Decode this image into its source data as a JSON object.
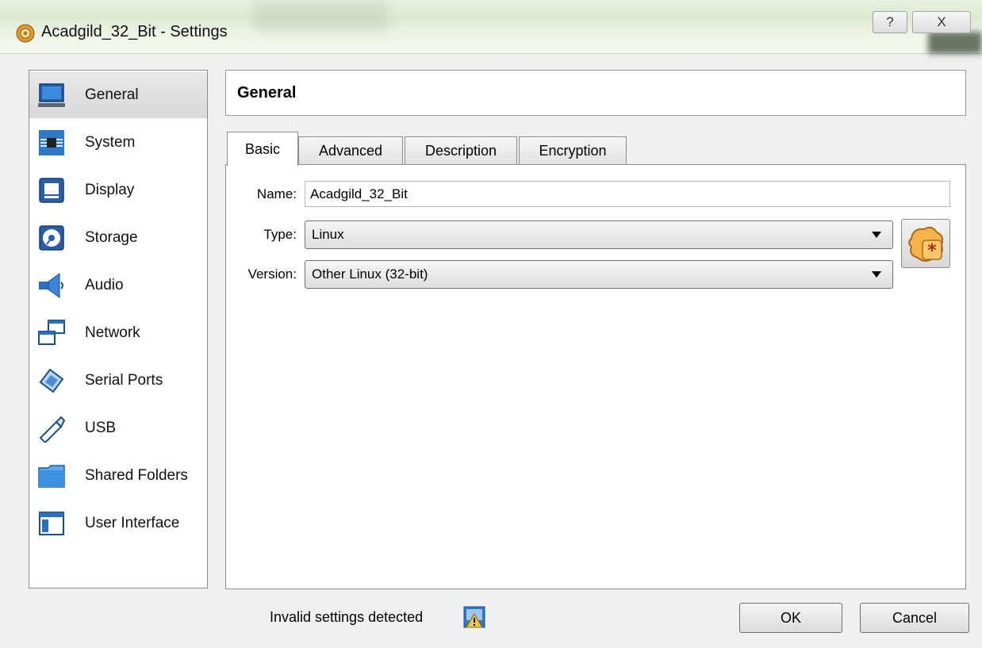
{
  "window": {
    "title": "Acadgild_32_Bit - Settings",
    "help_glyph": "?",
    "close_glyph": "X"
  },
  "sidebar": {
    "items": [
      {
        "label": "General",
        "icon": "monitor-icon",
        "selected": true
      },
      {
        "label": "System",
        "icon": "chip-icon"
      },
      {
        "label": "Display",
        "icon": "display-icon"
      },
      {
        "label": "Storage",
        "icon": "disk-icon"
      },
      {
        "label": "Audio",
        "icon": "speaker-icon"
      },
      {
        "label": "Network",
        "icon": "network-icon"
      },
      {
        "label": "Serial Ports",
        "icon": "serial-port-icon"
      },
      {
        "label": "USB",
        "icon": "usb-icon"
      },
      {
        "label": "Shared Folders",
        "icon": "folder-icon"
      },
      {
        "label": "User Interface",
        "icon": "window-icon"
      }
    ]
  },
  "main": {
    "title": "General",
    "tabs": [
      "Basic",
      "Advanced",
      "Description",
      "Encryption"
    ],
    "active_tab": "Basic",
    "fields": {
      "name_label": "Name:",
      "name_value": "Acadgild_32_Bit",
      "type_label": "Type:",
      "type_value": "Linux",
      "version_label": "Version:",
      "version_value": "Other Linux (32-bit)"
    }
  },
  "footer": {
    "invalid_text": "Invalid settings detected",
    "ok_label": "OK",
    "cancel_label": "Cancel"
  }
}
